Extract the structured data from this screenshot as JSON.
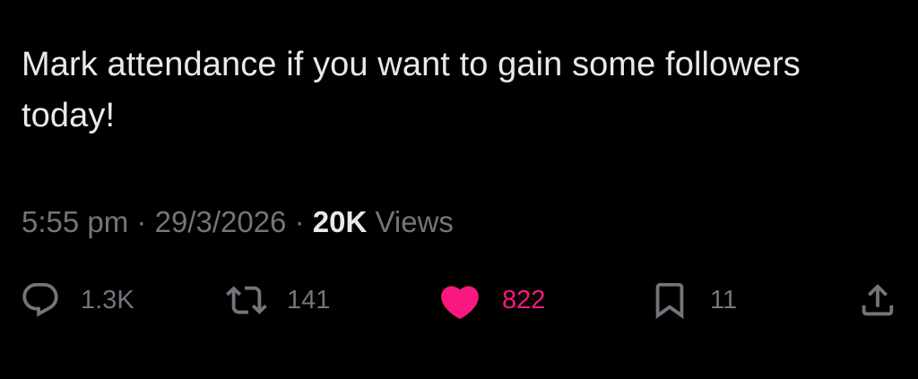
{
  "tweet": {
    "text": "Mark attendance if you want to gain some followers today!",
    "time": "5:55 pm",
    "date": "29/3/2026",
    "separator": "·",
    "views_count": "20K",
    "views_label": "Views"
  },
  "actions": {
    "reply": {
      "icon": "reply-icon",
      "count": "1.3K"
    },
    "retweet": {
      "icon": "retweet-icon",
      "count": "141"
    },
    "like": {
      "icon": "heart-icon",
      "count": "822",
      "liked": true
    },
    "bookmark": {
      "icon": "bookmark-icon",
      "count": "11"
    },
    "share": {
      "icon": "share-icon"
    }
  },
  "colors": {
    "background": "#000000",
    "text": "#e7e9ea",
    "secondary": "#71767b",
    "like": "#f91880"
  }
}
